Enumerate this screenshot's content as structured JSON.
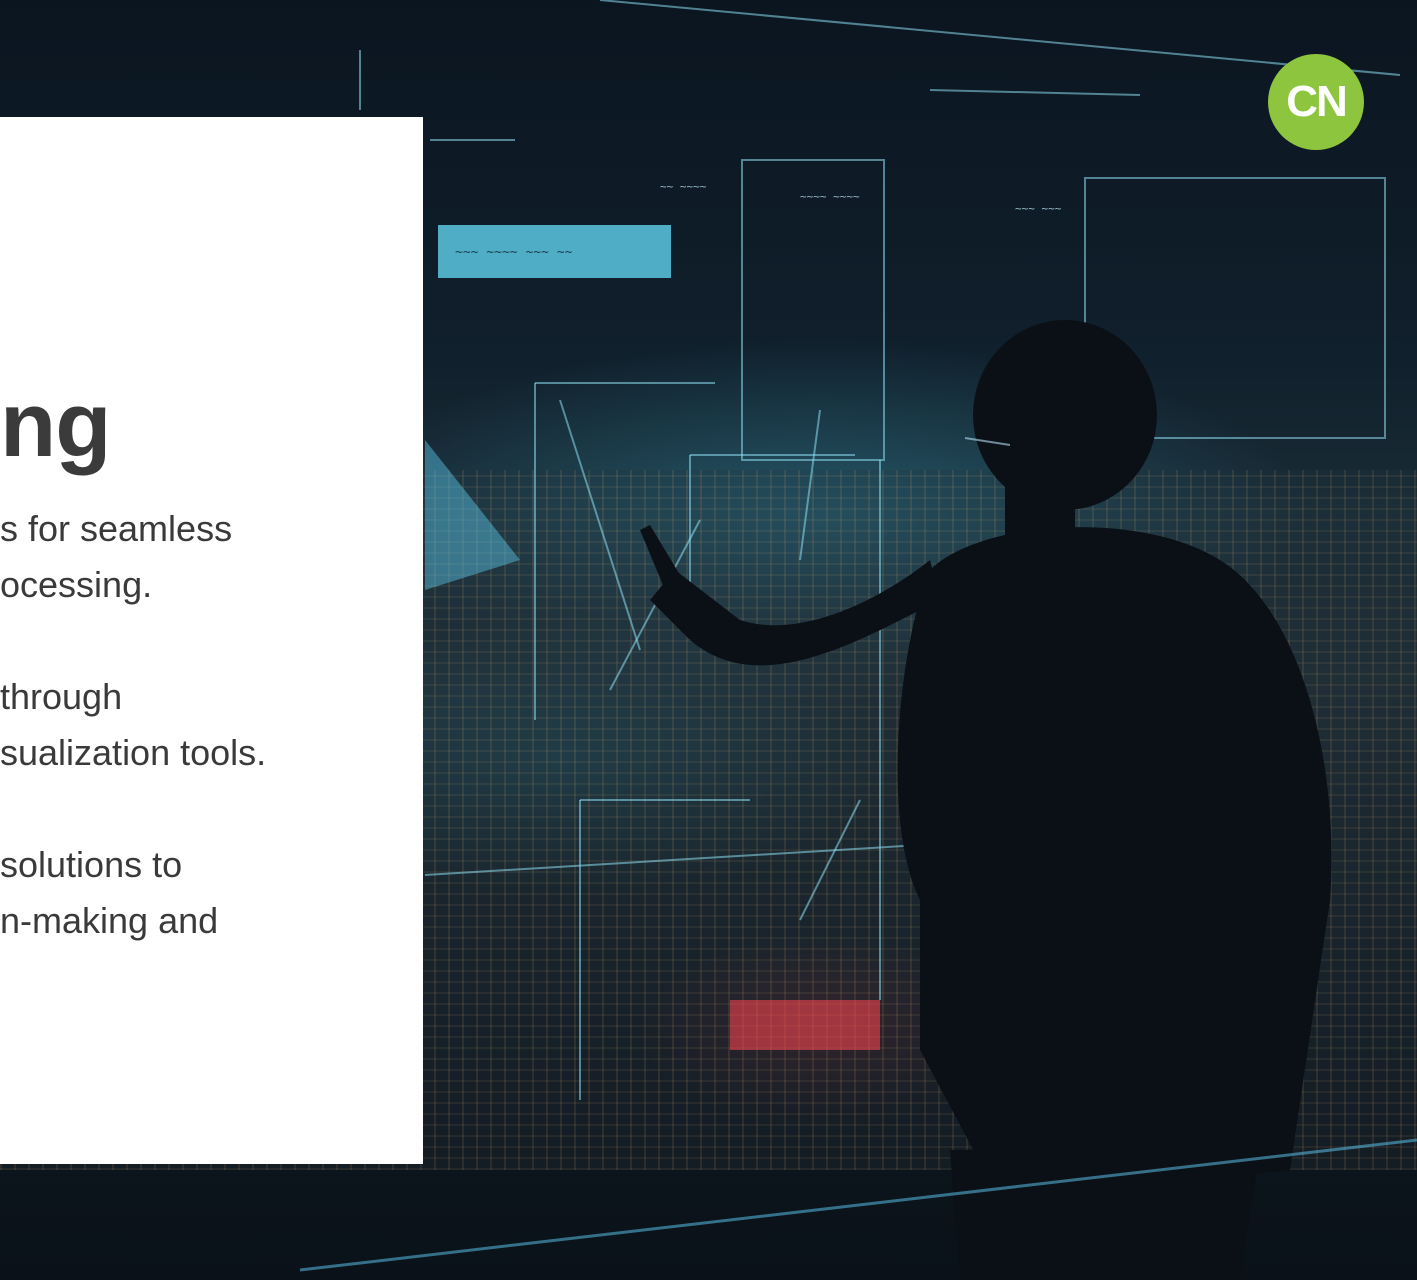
{
  "slide": {
    "heading": "ng",
    "bullets": [
      [
        "s for seamless",
        "ocessing."
      ],
      [
        " through",
        "sualization tools."
      ],
      [
        "solutions to",
        "n-making and"
      ]
    ]
  },
  "brand": {
    "logo_text": "CN",
    "logo_color": "#8dc53e"
  },
  "scene": {
    "description_icon": "person-pointing-at-holographic-display"
  }
}
